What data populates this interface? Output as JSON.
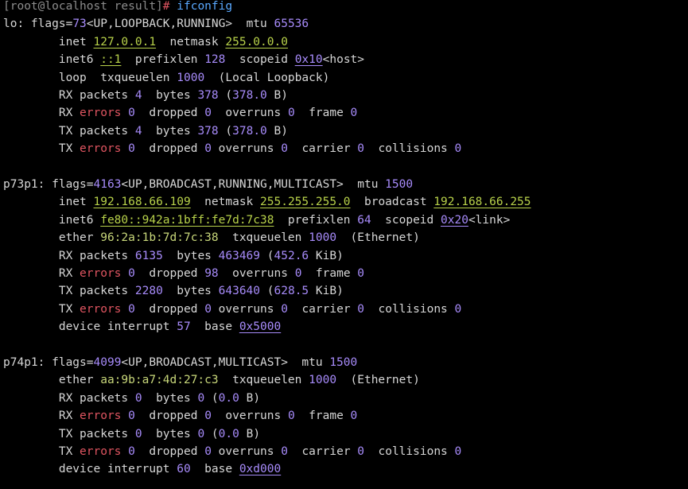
{
  "colors": {
    "background": "#000000",
    "text": "#d7d7d7",
    "number": "#a78bfa",
    "address": "#b8d24a",
    "error_word": "#e05561",
    "command": "#5aa9ff"
  },
  "lines": [
    [
      [
        "[root@localhost result]",
        "prompt"
      ],
      [
        "# ",
        "red"
      ],
      [
        "ifconfig",
        "cmd"
      ]
    ],
    [
      [
        "lo: flags=",
        ""
      ],
      [
        "73",
        "num"
      ],
      [
        "<UP,LOOPBACK,RUNNING>  mtu ",
        ""
      ],
      [
        "65536",
        "num"
      ]
    ],
    [
      [
        "        inet ",
        ""
      ],
      [
        "127.0.0.1",
        "ip"
      ],
      [
        "  netmask ",
        ""
      ],
      [
        "255.0.0.0",
        "ip"
      ]
    ],
    [
      [
        "        inet6 ",
        ""
      ],
      [
        "::1",
        "ip"
      ],
      [
        "  prefixlen ",
        ""
      ],
      [
        "128",
        "num"
      ],
      [
        "  scopeid ",
        ""
      ],
      [
        "0x10",
        "ulnum"
      ],
      [
        "<host>",
        ""
      ]
    ],
    [
      [
        "        loop  txqueuelen ",
        ""
      ],
      [
        "1000",
        "num"
      ],
      [
        "  (Local Loopback)",
        ""
      ]
    ],
    [
      [
        "        RX packets ",
        ""
      ],
      [
        "4",
        "num"
      ],
      [
        "  bytes ",
        ""
      ],
      [
        "378",
        "num"
      ],
      [
        " (",
        ""
      ],
      [
        "378.0",
        "num"
      ],
      [
        " B)",
        ""
      ]
    ],
    [
      [
        "        RX ",
        ""
      ],
      [
        "errors",
        "err"
      ],
      [
        " ",
        ""
      ],
      [
        "0",
        "num"
      ],
      [
        "  dropped ",
        ""
      ],
      [
        "0",
        "num"
      ],
      [
        "  overruns ",
        ""
      ],
      [
        "0",
        "num"
      ],
      [
        "  frame ",
        ""
      ],
      [
        "0",
        "num"
      ]
    ],
    [
      [
        "        TX packets ",
        ""
      ],
      [
        "4",
        "num"
      ],
      [
        "  bytes ",
        ""
      ],
      [
        "378",
        "num"
      ],
      [
        " (",
        ""
      ],
      [
        "378.0",
        "num"
      ],
      [
        " B)",
        ""
      ]
    ],
    [
      [
        "        TX ",
        ""
      ],
      [
        "errors",
        "err"
      ],
      [
        " ",
        ""
      ],
      [
        "0",
        "num"
      ],
      [
        "  dropped ",
        ""
      ],
      [
        "0",
        "num"
      ],
      [
        " overruns ",
        ""
      ],
      [
        "0",
        "num"
      ],
      [
        "  carrier ",
        ""
      ],
      [
        "0",
        "num"
      ],
      [
        "  collisions ",
        ""
      ],
      [
        "0",
        "num"
      ]
    ],
    [],
    [
      [
        "p73p1: flags=",
        ""
      ],
      [
        "4163",
        "num"
      ],
      [
        "<UP,BROADCAST,RUNNING,MULTICAST>  mtu ",
        ""
      ],
      [
        "1500",
        "num"
      ]
    ],
    [
      [
        "        inet ",
        ""
      ],
      [
        "192.168.66.109",
        "ip"
      ],
      [
        "  netmask ",
        ""
      ],
      [
        "255.255.255.0",
        "ip"
      ],
      [
        "  broadcast ",
        ""
      ],
      [
        "192.168.66.255",
        "ip"
      ]
    ],
    [
      [
        "        inet6 ",
        ""
      ],
      [
        "fe80::942a:1bff:fe7d:7c38",
        "ip"
      ],
      [
        "  prefixlen ",
        ""
      ],
      [
        "64",
        "num"
      ],
      [
        "  scopeid ",
        ""
      ],
      [
        "0x20",
        "ulnum"
      ],
      [
        "<link>",
        ""
      ]
    ],
    [
      [
        "        ether ",
        ""
      ],
      [
        "96:2a:1b:7d:7c:38",
        "mac"
      ],
      [
        "  txqueuelen ",
        ""
      ],
      [
        "1000",
        "num"
      ],
      [
        "  (Ethernet)",
        ""
      ]
    ],
    [
      [
        "        RX packets ",
        ""
      ],
      [
        "6135",
        "num"
      ],
      [
        "  bytes ",
        ""
      ],
      [
        "463469",
        "num"
      ],
      [
        " (",
        ""
      ],
      [
        "452.6",
        "num"
      ],
      [
        " KiB)",
        ""
      ]
    ],
    [
      [
        "        RX ",
        ""
      ],
      [
        "errors",
        "err"
      ],
      [
        " ",
        ""
      ],
      [
        "0",
        "num"
      ],
      [
        "  dropped ",
        ""
      ],
      [
        "98",
        "num"
      ],
      [
        "  overruns ",
        ""
      ],
      [
        "0",
        "num"
      ],
      [
        "  frame ",
        ""
      ],
      [
        "0",
        "num"
      ]
    ],
    [
      [
        "        TX packets ",
        ""
      ],
      [
        "2280",
        "num"
      ],
      [
        "  bytes ",
        ""
      ],
      [
        "643640",
        "num"
      ],
      [
        " (",
        ""
      ],
      [
        "628.5",
        "num"
      ],
      [
        " KiB)",
        ""
      ]
    ],
    [
      [
        "        TX ",
        ""
      ],
      [
        "errors",
        "err"
      ],
      [
        " ",
        ""
      ],
      [
        "0",
        "num"
      ],
      [
        "  dropped ",
        ""
      ],
      [
        "0",
        "num"
      ],
      [
        " overruns ",
        ""
      ],
      [
        "0",
        "num"
      ],
      [
        "  carrier ",
        ""
      ],
      [
        "0",
        "num"
      ],
      [
        "  collisions ",
        ""
      ],
      [
        "0",
        "num"
      ]
    ],
    [
      [
        "        device interrupt ",
        ""
      ],
      [
        "57",
        "num"
      ],
      [
        "  base ",
        ""
      ],
      [
        "0x5000",
        "ulnum"
      ]
    ],
    [],
    [
      [
        "p74p1: flags=",
        ""
      ],
      [
        "4099",
        "num"
      ],
      [
        "<UP,BROADCAST,MULTICAST>  mtu ",
        ""
      ],
      [
        "1500",
        "num"
      ]
    ],
    [
      [
        "        ether ",
        ""
      ],
      [
        "aa:9b:a7:4d:27:c3",
        "mac"
      ],
      [
        "  txqueuelen ",
        ""
      ],
      [
        "1000",
        "num"
      ],
      [
        "  (Ethernet)",
        ""
      ]
    ],
    [
      [
        "        RX packets ",
        ""
      ],
      [
        "0",
        "num"
      ],
      [
        "  bytes ",
        ""
      ],
      [
        "0",
        "num"
      ],
      [
        " (",
        ""
      ],
      [
        "0.0",
        "num"
      ],
      [
        " B)",
        ""
      ]
    ],
    [
      [
        "        RX ",
        ""
      ],
      [
        "errors",
        "err"
      ],
      [
        " ",
        ""
      ],
      [
        "0",
        "num"
      ],
      [
        "  dropped ",
        ""
      ],
      [
        "0",
        "num"
      ],
      [
        "  overruns ",
        ""
      ],
      [
        "0",
        "num"
      ],
      [
        "  frame ",
        ""
      ],
      [
        "0",
        "num"
      ]
    ],
    [
      [
        "        TX packets ",
        ""
      ],
      [
        "0",
        "num"
      ],
      [
        "  bytes ",
        ""
      ],
      [
        "0",
        "num"
      ],
      [
        " (",
        ""
      ],
      [
        "0.0",
        "num"
      ],
      [
        " B)",
        ""
      ]
    ],
    [
      [
        "        TX ",
        ""
      ],
      [
        "errors",
        "err"
      ],
      [
        " ",
        ""
      ],
      [
        "0",
        "num"
      ],
      [
        "  dropped ",
        ""
      ],
      [
        "0",
        "num"
      ],
      [
        " overruns ",
        ""
      ],
      [
        "0",
        "num"
      ],
      [
        "  carrier ",
        ""
      ],
      [
        "0",
        "num"
      ],
      [
        "  collisions ",
        ""
      ],
      [
        "0",
        "num"
      ]
    ],
    [
      [
        "        device interrupt ",
        ""
      ],
      [
        "60",
        "num"
      ],
      [
        "  base ",
        ""
      ],
      [
        "0xd000",
        "ulnum"
      ]
    ]
  ]
}
